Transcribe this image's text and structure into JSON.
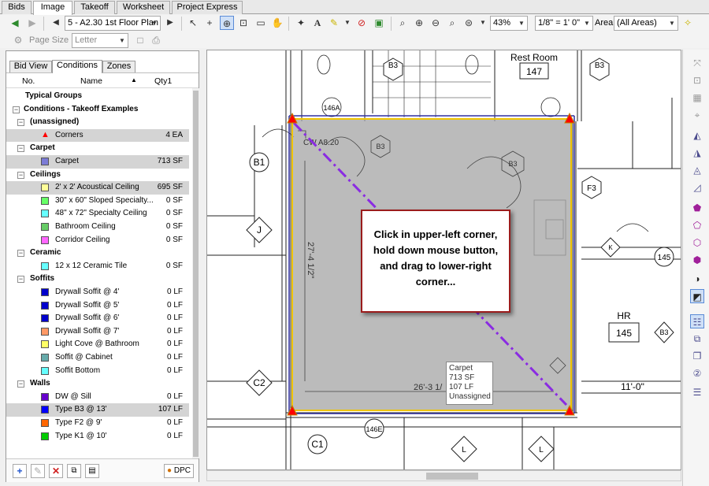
{
  "top_tabs": [
    "Bids",
    "Image",
    "Takeoff",
    "Worksheet",
    "Project Express"
  ],
  "active_tab": "Image",
  "toolbar": {
    "page_select": "5 - A2.30 1st Floor Plan",
    "zoom": "43%",
    "scale": "1/8\" = 1' 0\"",
    "area_label": "Area",
    "area_select": "(All Areas)",
    "page_size_label": "Page Size",
    "page_size_value": "Letter"
  },
  "panel_tabs": [
    "Bid View",
    "Conditions",
    "Zones"
  ],
  "active_panel_tab": "Conditions",
  "list_header": {
    "no": "No.",
    "name": "Name",
    "qty": "Qty1"
  },
  "rows": [
    {
      "type": "root",
      "label": "Typical Groups"
    },
    {
      "type": "group",
      "label": "Conditions - Takeoff Examples",
      "indent": 0
    },
    {
      "type": "group",
      "label": "(unassigned)"
    },
    {
      "type": "item",
      "label": "Corners",
      "qty": "4 EA",
      "color": "#ff0000",
      "shape": "triangle",
      "shade": true
    },
    {
      "type": "group",
      "label": "Carpet"
    },
    {
      "type": "item",
      "label": "Carpet",
      "qty": "713 SF",
      "color": "#7b7bd6",
      "shade": true
    },
    {
      "type": "group",
      "label": "Ceilings"
    },
    {
      "type": "item",
      "label": "2' x 2' Acoustical Ceiling",
      "qty": "695 SF",
      "color": "#ffff99",
      "shade": true
    },
    {
      "type": "item",
      "label": "30\" x 60\" Sloped Specialty...",
      "qty": "0 SF",
      "color": "#66ff66"
    },
    {
      "type": "item",
      "label": "48\" x 72\" Specialty Ceiling",
      "qty": "0 SF",
      "color": "#66ffff"
    },
    {
      "type": "item",
      "label": "Bathroom Ceiling",
      "qty": "0 SF",
      "color": "#66cc66"
    },
    {
      "type": "item",
      "label": "Corridor Ceiling",
      "qty": "0 SF",
      "color": "#ff66ff"
    },
    {
      "type": "group",
      "label": "Ceramic"
    },
    {
      "type": "item",
      "label": "12 x 12 Ceramic Tile",
      "qty": "0 SF",
      "color": "#66ffff"
    },
    {
      "type": "group",
      "label": "Soffits"
    },
    {
      "type": "item",
      "label": "Drywall Soffit @ 4'",
      "qty": "0 LF",
      "color": "#0000cc"
    },
    {
      "type": "item",
      "label": "Drywall Soffit @ 5'",
      "qty": "0 LF",
      "color": "#0000cc"
    },
    {
      "type": "item",
      "label": "Drywall Soffit @ 6'",
      "qty": "0 LF",
      "color": "#0000cc"
    },
    {
      "type": "item",
      "label": "Drywall Soffit @ 7'",
      "qty": "0 LF",
      "color": "#ff9966"
    },
    {
      "type": "item",
      "label": "Light Cove @ Bathroom",
      "qty": "0 LF",
      "color": "#ffff66"
    },
    {
      "type": "item",
      "label": "Soffit @ Cabinet",
      "qty": "0 LF",
      "color": "#66aaaa"
    },
    {
      "type": "item",
      "label": "Soffit Bottom",
      "qty": "0 LF",
      "color": "#66ffff"
    },
    {
      "type": "group",
      "label": "Walls"
    },
    {
      "type": "item",
      "label": "DW @ Sill",
      "qty": "0 LF",
      "color": "#6600cc"
    },
    {
      "type": "item",
      "label": "Type B3 @ 13'",
      "qty": "107 LF",
      "color": "#0000ff",
      "shade": true
    },
    {
      "type": "item",
      "label": "Type F2 @ 9'",
      "qty": "0 LF",
      "color": "#ff6600"
    },
    {
      "type": "item",
      "label": "Type K1 @ 10'",
      "qty": "0 LF",
      "color": "#00cc00"
    }
  ],
  "footer": {
    "dpc_label": "DPC"
  },
  "drawing": {
    "rest_room": "Rest Room",
    "room_147": "147",
    "b3_label": "B3",
    "dim_vertical": "27'-4 1/2\"",
    "dim_horizontal": "26'-3 1/",
    "dim_right": "11'-0\"",
    "hr_label": "HR",
    "room_145": "145",
    "wall_code": "CW A8.20",
    "tags": {
      "b1": "B1",
      "j": "J",
      "c2": "C2",
      "c1": "C1",
      "f3": "F3",
      "k": "K",
      "b3": "B3",
      "a146": "146A",
      "e146": "146E",
      "l": "L",
      "v145": "145"
    }
  },
  "callout_text": "Click in upper-left corner, hold down mouse button, and drag to lower-right corner...",
  "tooltip": {
    "line1": "Carpet",
    "line2": "713 SF",
    "line3": "107 LF",
    "line4": "Unassigned"
  }
}
